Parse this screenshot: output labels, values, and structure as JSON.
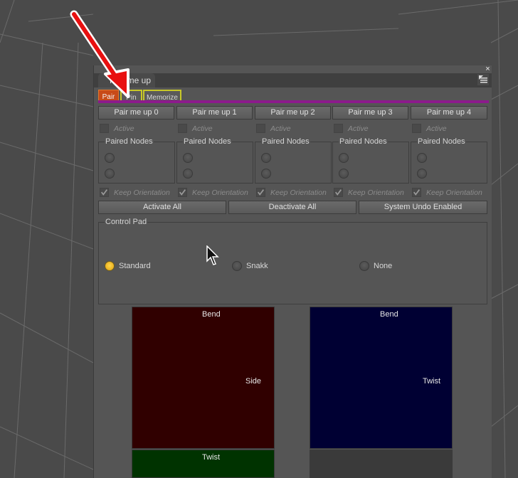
{
  "window": {
    "title": "Pair me up",
    "close_glyph": "×"
  },
  "tabs": [
    {
      "label": "Pair",
      "active": true
    },
    {
      "label": "Pin",
      "active": false
    },
    {
      "label": "Memorize",
      "active": false
    }
  ],
  "pairs": [
    {
      "button": "Pair me up 0",
      "active_label": "Active",
      "group_title": "Paired Nodes",
      "keep_label": "Keep Orientation"
    },
    {
      "button": "Pair me up 1",
      "active_label": "Active",
      "group_title": "Paired Nodes",
      "keep_label": "Keep Orientation"
    },
    {
      "button": "Pair me up 2",
      "active_label": "Active",
      "group_title": "Paired Nodes",
      "keep_label": "Keep Orientation"
    },
    {
      "button": "Pair me up 3",
      "active_label": "Active",
      "group_title": "Paired Nodes",
      "keep_label": "Keep Orientation"
    },
    {
      "button": "Pair me up 4",
      "active_label": "Active",
      "group_title": "Paired Nodes",
      "keep_label": "Keep Orientation"
    }
  ],
  "actions": {
    "activate_all": "Activate All",
    "deactivate_all": "Deactivate All",
    "system_undo": "System Undo Enabled"
  },
  "control_pad": {
    "title": "Control Pad",
    "options": [
      {
        "label": "Standard",
        "selected": true
      },
      {
        "label": "Snakk",
        "selected": false
      },
      {
        "label": "None",
        "selected": false
      }
    ]
  },
  "pads": {
    "red": {
      "top": "Bend",
      "right": "Side",
      "color": "#300000"
    },
    "blue": {
      "top": "Bend",
      "right": "Twist",
      "color": "#000033"
    },
    "green": {
      "top": "Twist",
      "color": "#003300"
    }
  },
  "colors": {
    "accent_tab": "#c84a18",
    "tab_border": "#c8c828",
    "purple_bar": "#8c1a8c",
    "radio_on": "#f0b820",
    "arrow": "#e81010"
  }
}
